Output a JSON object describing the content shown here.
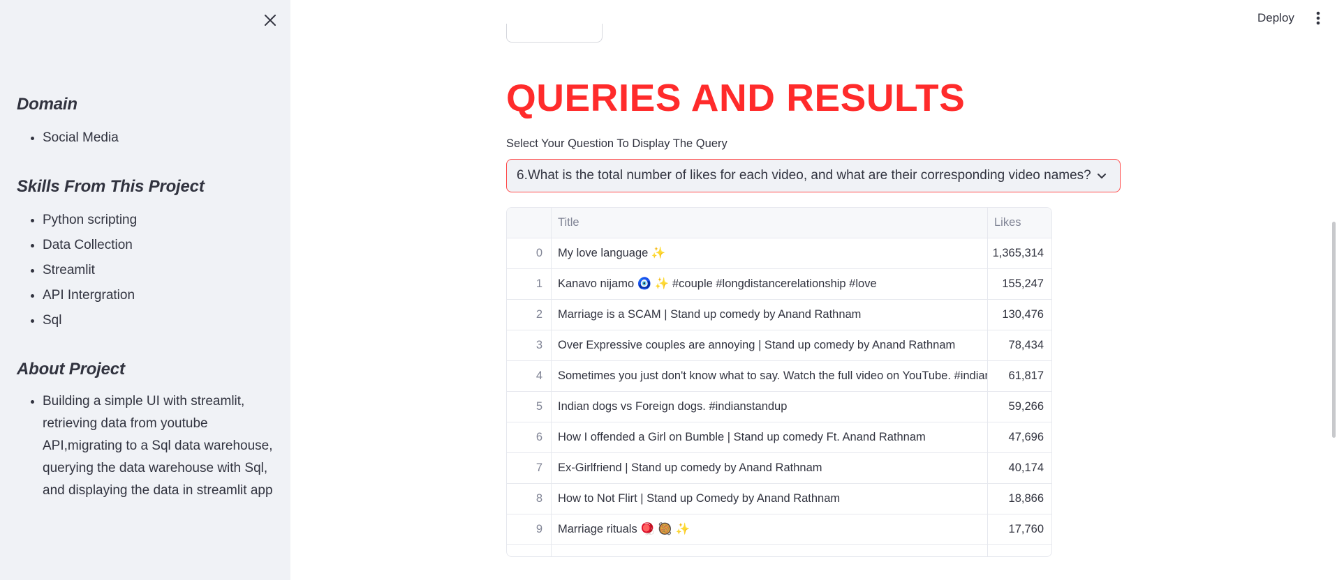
{
  "sidebar": {
    "close_icon": "close-icon",
    "sections": [
      {
        "heading": "Domain",
        "items": [
          "Social Media"
        ]
      },
      {
        "heading": "Skills From This Project",
        "items": [
          "Python scripting",
          "Data Collection",
          "Streamlit",
          "API Intergration",
          "Sql"
        ]
      },
      {
        "heading": "About Project",
        "items": [
          "Building a simple UI with streamlit, retrieving data from youtube API,migrating to a Sql data warehouse, querying the data warehouse with Sql, and displaying the data in streamlit app"
        ]
      }
    ]
  },
  "header": {
    "deploy_label": "Deploy",
    "menu_icon": "kebab-menu-icon"
  },
  "main": {
    "title": "QUERIES AND RESULTS",
    "select_label": "Select Your Question To Display The Query",
    "select_value": "6.What is the total number of likes for each video, and what are their corresponding video names?",
    "accent_color": "#ff2b2b",
    "table": {
      "columns": [
        "",
        "Title",
        "Likes"
      ],
      "rows": [
        [
          "0",
          "My love language ✨",
          "1,365,314"
        ],
        [
          "1",
          "Kanavo nijamo 🧿 ✨ #couple #longdistancerelationship #love",
          "155,247"
        ],
        [
          "2",
          "Marriage is a SCAM | Stand up comedy by Anand Rathnam",
          "130,476"
        ],
        [
          "3",
          "Over Expressive couples are annoying | Stand up comedy by Anand Rathnam",
          "78,434"
        ],
        [
          "4",
          "Sometimes you just don't know what to say. Watch the full video on YouTube. #indianstandup",
          "61,817"
        ],
        [
          "5",
          "Indian dogs vs Foreign dogs. #indianstandup",
          "59,266"
        ],
        [
          "6",
          "How I offended a Girl on Bumble | Stand up comedy Ft. Anand Rathnam",
          "47,696"
        ],
        [
          "7",
          "Ex-Girlfriend | Stand up comedy by Anand Rathnam",
          "40,174"
        ],
        [
          "8",
          "How to Not Flirt | Stand up Comedy by Anand Rathnam",
          "18,866"
        ],
        [
          "9",
          "Marriage rituals 🪀 🥘 ✨",
          "17,760"
        ]
      ]
    }
  }
}
